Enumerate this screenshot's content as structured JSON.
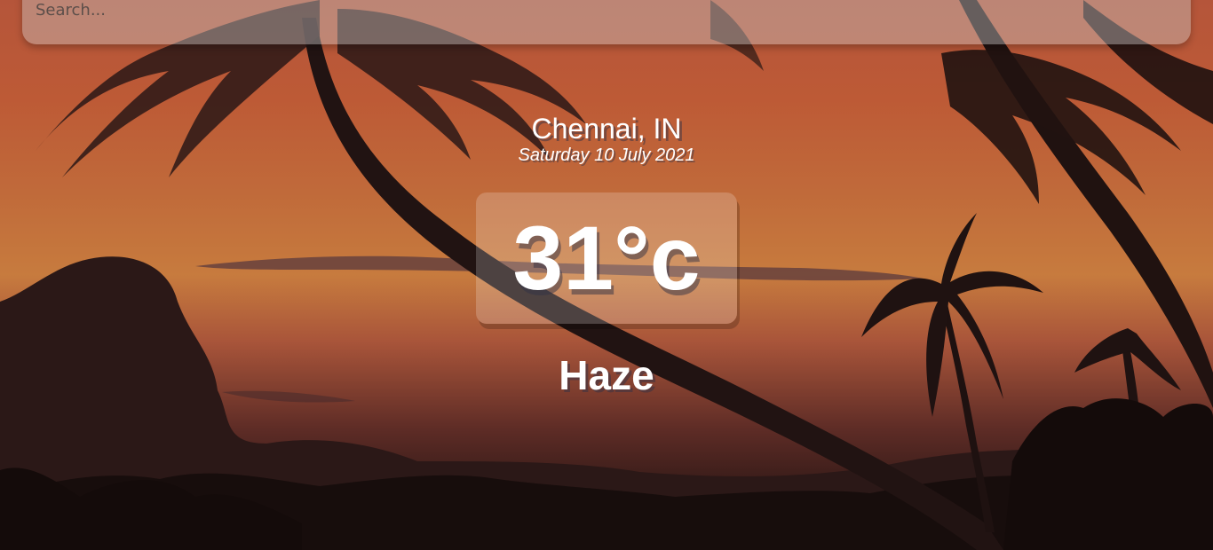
{
  "search": {
    "placeholder": "Search..."
  },
  "location": {
    "city": "Chennai, IN",
    "date": "Saturday 10 July 2021"
  },
  "weather": {
    "temperature": "31°c",
    "condition": "Haze"
  },
  "colors": {
    "sky_top": "#b5553a",
    "sky_mid": "#c77b3e",
    "ground": "#1a0f0e",
    "text": "#ffffff"
  }
}
